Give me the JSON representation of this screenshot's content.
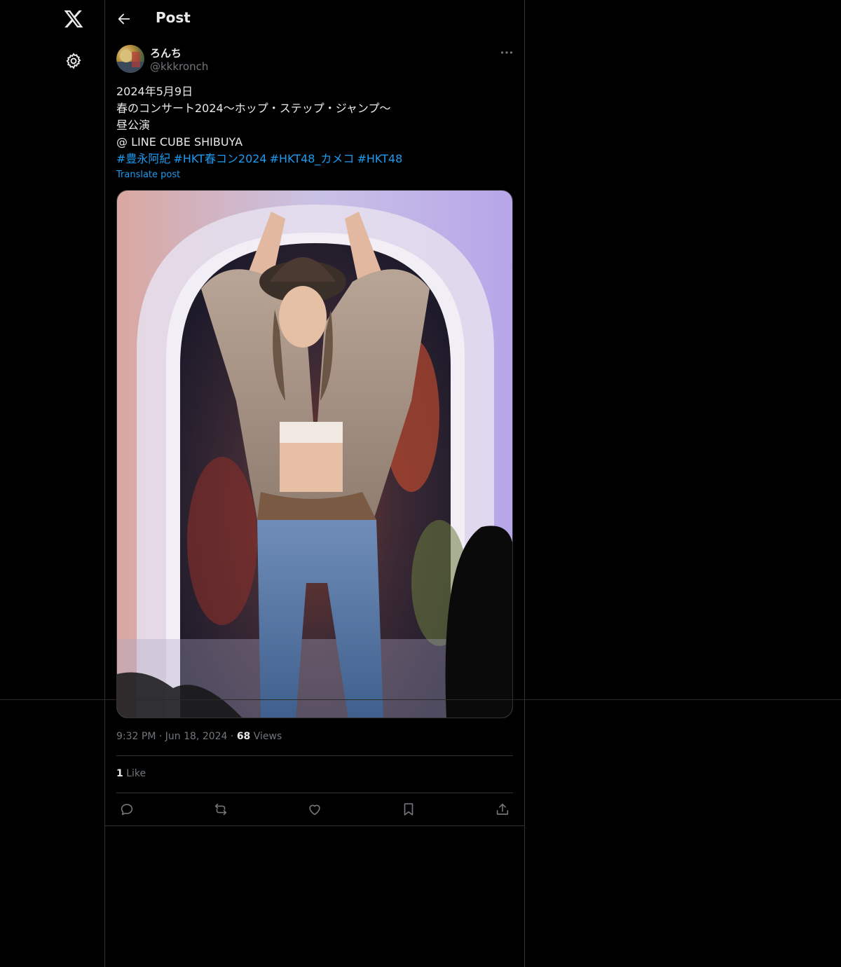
{
  "header": {
    "title": "Post"
  },
  "author": {
    "display_name": "ろんち",
    "handle": "@kkkronch"
  },
  "post": {
    "lines": [
      "2024年5月9日",
      "春のコンサート2024〜ホップ・ステップ・ジャンプ〜",
      "昼公演",
      "@ LINE CUBE SHIBUYA"
    ],
    "hashtags": [
      "#豊永阿紀",
      "#HKT春コン2024",
      "#HKT48_カメコ",
      "#HKT48"
    ],
    "translate_label": "Translate post"
  },
  "meta": {
    "time": "9:32 PM",
    "date": "Jun 18, 2024",
    "views_count": "68",
    "views_label": "Views"
  },
  "stats": {
    "likes_count": "1",
    "likes_label": "Like"
  },
  "icons": {
    "logo": "x-logo-icon",
    "settings": "gear-icon",
    "back": "arrow-left-icon",
    "more": "more-horizontal-icon",
    "reply": "reply-icon",
    "repost": "repost-icon",
    "like": "heart-icon",
    "bookmark": "bookmark-icon",
    "share": "share-icon"
  },
  "colors": {
    "background": "#000000",
    "accent": "#1d9bf0",
    "text": "#e7e9ea",
    "muted": "#71767b",
    "border": "#2f3336"
  }
}
